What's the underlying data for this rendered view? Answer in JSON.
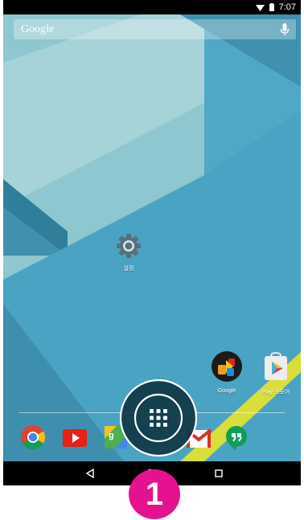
{
  "status_bar": {
    "time": "7:07",
    "wifi_icon": "wifi-icon",
    "battery_icon": "battery-icon"
  },
  "search_bar": {
    "logo_text": "Google",
    "mic_icon": "mic-icon"
  },
  "home_icons": [
    {
      "label": "설정",
      "icon": "settings-gear-icon"
    },
    {
      "label": "Google",
      "icon": "google-folder-icon"
    },
    {
      "label": "Play 스토어",
      "icon": "play-store-icon"
    }
  ],
  "dock": [
    {
      "name": "chrome-icon"
    },
    {
      "name": "youtube-icon"
    },
    {
      "name": "maps-icon"
    },
    {
      "name": "app-drawer-icon"
    },
    {
      "name": "gmail-icon"
    },
    {
      "name": "hangouts-icon"
    }
  ],
  "nav_bar": {
    "back": "back-icon",
    "home": "home-icon",
    "recents": "recents-icon"
  },
  "step_badge": {
    "number": "1"
  },
  "colors": {
    "badge": "#e4128f",
    "wallpaper_light": "#a6d3d8",
    "wallpaper_mid": "#4fa8c6",
    "wallpaper_dark": "#2f6f87",
    "accent_yellow": "#d8de3a"
  }
}
